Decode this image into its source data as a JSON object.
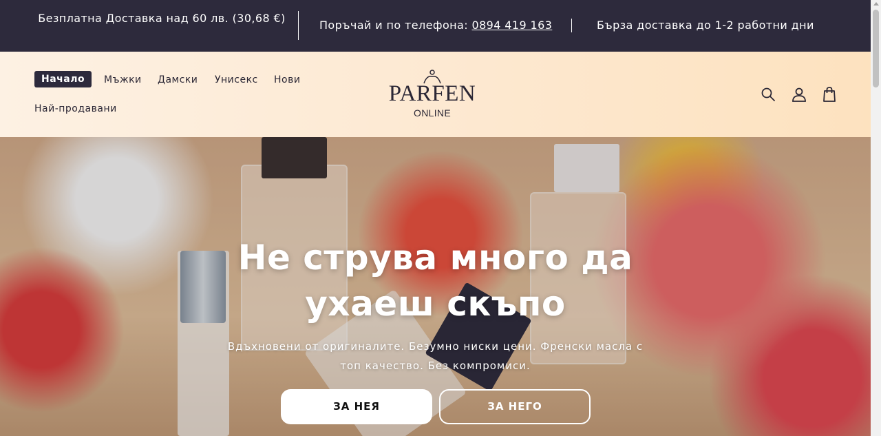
{
  "announcement": {
    "free_shipping": "Безплатна Доставка над 60 лв. (30,68 €)",
    "order_by_phone_label": "Поръчай и по телефона: ",
    "phone": "0894 419 163",
    "fast_delivery": "Бърза доставка до 1-2 работни дни"
  },
  "nav": {
    "items": [
      {
        "label": "Начало",
        "active": true
      },
      {
        "label": "Мъжки"
      },
      {
        "label": "Дамски"
      },
      {
        "label": "Унисекс"
      },
      {
        "label": "Нови"
      },
      {
        "label": "Най-продавани"
      }
    ]
  },
  "logo": {
    "text": "PARFEN",
    "subtext": "ONLINE"
  },
  "header_icons": [
    "search-icon",
    "account-icon",
    "cart-icon"
  ],
  "hero": {
    "title": "Не струва много да ухаеш скъпо",
    "subtitle": "Вдъхновени от оригиналите. Безумно ниски цени. Френски масла с топ качество. Без компромиси.",
    "button_her": "ЗА НЕЯ",
    "button_him": "ЗА НЕГО"
  },
  "colors": {
    "dark": "#2d2a3c",
    "header_gradient_start": "#fdf1e3",
    "header_gradient_end": "#fde2bf"
  }
}
